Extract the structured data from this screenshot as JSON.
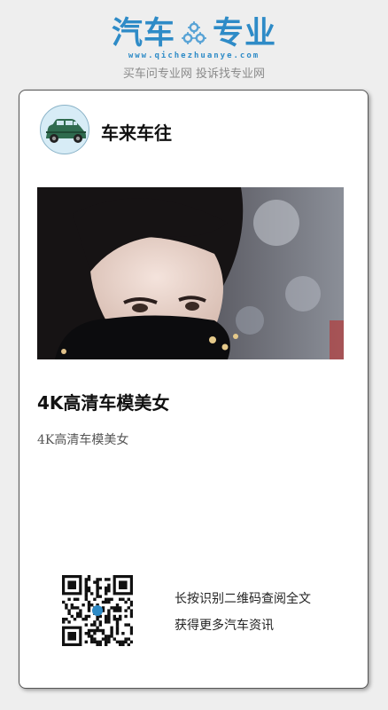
{
  "brand": {
    "word_left": "汽车",
    "word_right": "专业",
    "url": "www.qichezhuanye.com",
    "tagline": "买车问专业网 投诉找专业网",
    "color": "#2e8bc7"
  },
  "channel": {
    "name": "车来车往",
    "avatar_icon": "car-icon"
  },
  "article": {
    "title": "4K高清车模美女",
    "summary": "4K高清车模美女"
  },
  "qr": {
    "line1": "长按识别二维码查阅全文",
    "line2": "获得更多汽车资讯"
  }
}
